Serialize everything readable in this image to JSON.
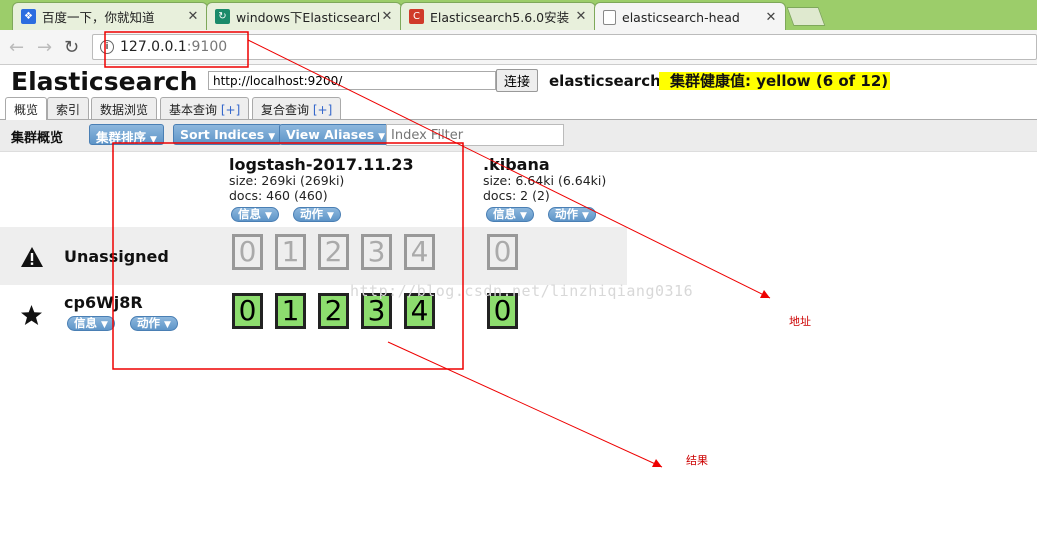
{
  "browser": {
    "tabs": [
      {
        "title": "百度一下，你就知道",
        "favicon": "baidu-paw-icon",
        "color": "#2b6de0"
      },
      {
        "title": "windows下Elasticsearch",
        "favicon": "sync-icon",
        "color": "#1a8a6a"
      },
      {
        "title": "Elasticsearch5.6.0安装",
        "favicon": "csdn-c-icon",
        "color": "#d03a2a"
      },
      {
        "title": "elasticsearch-head",
        "favicon": "page-icon",
        "color": "#888888"
      }
    ],
    "close_glyph": "✕",
    "address": {
      "host": "127.0.0.1",
      "port": ":9100"
    }
  },
  "es": {
    "title": "Elasticsearch",
    "url_value": "http://localhost:9200/",
    "connect_label": "连接",
    "cluster_name": "elasticsearch",
    "health": "集群健康值: yellow (6 of 12)",
    "health_color": "#ffff00",
    "tabs": [
      {
        "label": "概览",
        "plus": ""
      },
      {
        "label": "索引",
        "plus": ""
      },
      {
        "label": "数据浏览",
        "plus": ""
      },
      {
        "label": "基本查询 ",
        "plus": "[+]"
      },
      {
        "label": "复合查询 ",
        "plus": "[+]"
      }
    ],
    "overview": {
      "title": "集群概览",
      "sort_label": "集群排序",
      "sort_indices_label": "Sort Indices",
      "view_aliases_label": "View Aliases",
      "filter_placeholder": "Index Filter"
    },
    "indices": [
      {
        "name": "logstash-2017.11.23",
        "size": "size: 269ki (269ki)",
        "docs": "docs: 460 (460)",
        "info": "信息",
        "action": "动作"
      },
      {
        "name": ".kibana",
        "size": "size: 6.64ki (6.64ki)",
        "docs": "docs: 2 (2)",
        "info": "信息",
        "action": "动作"
      }
    ],
    "unassigned": {
      "label": "Unassigned",
      "shards_logstash": [
        "0",
        "1",
        "2",
        "3",
        "4"
      ],
      "shards_kibana": [
        "0"
      ]
    },
    "node": {
      "name": "cp6Wj8R",
      "info": "信息",
      "action": "动作",
      "shards_logstash": [
        "0",
        "1",
        "2",
        "3",
        "4"
      ],
      "shards_kibana": [
        "0"
      ]
    },
    "shard_started_color": "#8ddd6e"
  },
  "annotations": {
    "address_note": "地址",
    "result_note": "结果",
    "watermark": "http://blog.csdn.net/linzhiqiang0316"
  }
}
